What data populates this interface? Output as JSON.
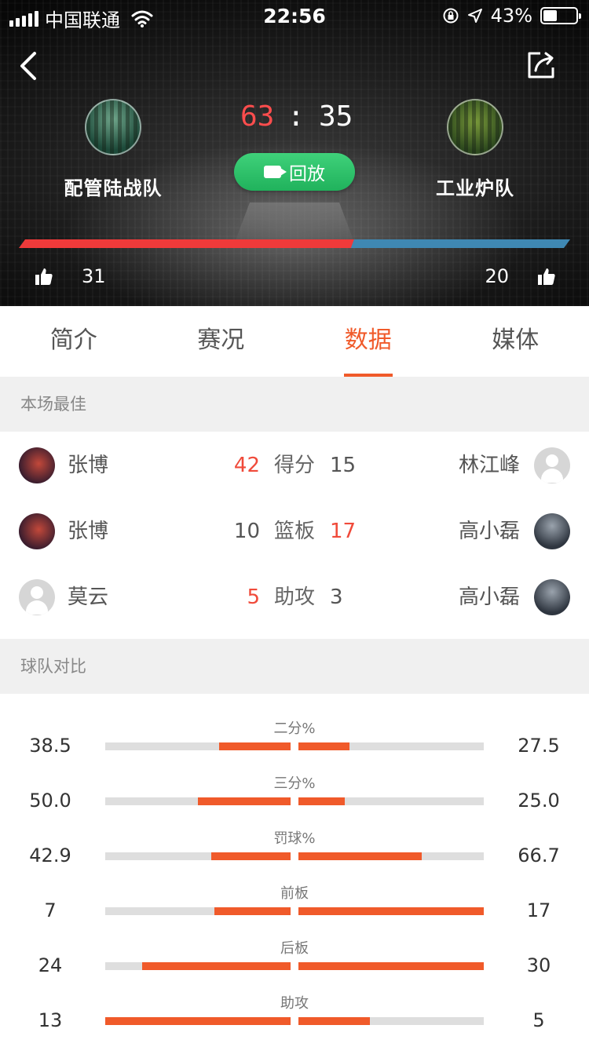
{
  "status_bar": {
    "carrier": "中国联通",
    "time": "22:56",
    "battery": "43%",
    "battery_level": 0.43
  },
  "match": {
    "home_team": "配管陆战队",
    "away_team": "工业炉队",
    "home_score": "63",
    "separator": ":",
    "away_score": "35",
    "replay_label": "回放",
    "home_likes": "31",
    "away_likes": "20",
    "home_like_share": 0.608
  },
  "tabs": [
    {
      "label": "简介",
      "active": false
    },
    {
      "label": "赛况",
      "active": false
    },
    {
      "label": "数据",
      "active": true
    },
    {
      "label": "媒体",
      "active": false
    }
  ],
  "best_section": {
    "title": "本场最佳",
    "rows": [
      {
        "left_name": "张博",
        "left_value": "42",
        "stat": "得分",
        "right_value": "15",
        "right_name": "林江峰",
        "leader": "left"
      },
      {
        "left_name": "张博",
        "left_value": "10",
        "stat": "篮板",
        "right_value": "17",
        "right_name": "高小磊",
        "leader": "right"
      },
      {
        "left_name": "莫云",
        "left_value": "5",
        "stat": "助攻",
        "right_value": "3",
        "right_name": "高小磊",
        "leader": "left"
      }
    ]
  },
  "compare_section": {
    "title": "球队对比",
    "rows": [
      {
        "label": "二分%",
        "left": "38.5",
        "right": "27.5",
        "left_fraction": 0.385,
        "right_fraction": 0.275
      },
      {
        "label": "三分%",
        "left": "50.0",
        "right": "25.0",
        "left_fraction": 0.5,
        "right_fraction": 0.25
      },
      {
        "label": "罚球%",
        "left": "42.9",
        "right": "66.7",
        "left_fraction": 0.429,
        "right_fraction": 0.667
      },
      {
        "label": "前板",
        "left": "7",
        "right": "17",
        "left_fraction": 0.41,
        "right_fraction": 1.0
      },
      {
        "label": "后板",
        "left": "24",
        "right": "30",
        "left_fraction": 0.8,
        "right_fraction": 1.0
      },
      {
        "label": "助攻",
        "left": "13",
        "right": "5",
        "left_fraction": 1.0,
        "right_fraction": 0.385
      }
    ]
  },
  "colors": {
    "accent": "#f05a2a",
    "home_bar": "#ef3a3a",
    "away_bar": "#3f88b3",
    "replay_green": "#2cc66b",
    "highlight_value": "#f04a3a"
  }
}
